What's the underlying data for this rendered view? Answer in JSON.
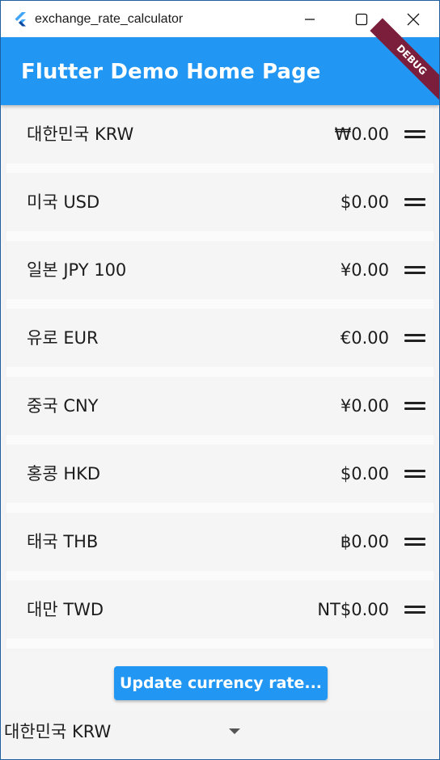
{
  "window": {
    "title": "exchange_rate_calculator",
    "minimize_icon": "minimize-icon",
    "maximize_icon": "maximize-icon",
    "close_icon": "close-icon"
  },
  "appbar": {
    "title": "Flutter Demo Home Page",
    "color": "#2196f3",
    "debug_banner": "DEBUG"
  },
  "currencies": [
    {
      "label": "대한민국 KRW",
      "value": "₩0.00"
    },
    {
      "label": "미국 USD",
      "value": "$0.00"
    },
    {
      "label": "일본 JPY 100",
      "value": "¥0.00"
    },
    {
      "label": "유로 EUR",
      "value": "€0.00"
    },
    {
      "label": "중국 CNY",
      "value": "¥0.00"
    },
    {
      "label": "홍콩 HKD",
      "value": "$0.00"
    },
    {
      "label": "태국 THB",
      "value": "฿0.00"
    },
    {
      "label": "대만 TWD",
      "value": "NT$0.00"
    }
  ],
  "update_button": {
    "label": "Update currency rate..."
  },
  "base_currency_select": {
    "selected": "대한민국 KRW"
  }
}
